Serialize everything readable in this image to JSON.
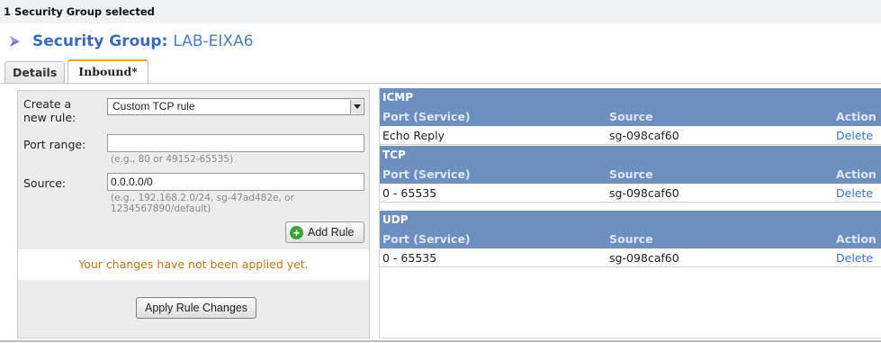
{
  "selection_bar": {
    "text": "1 Security Group selected"
  },
  "header": {
    "label": "Security Group:",
    "name": "LAB-EIXA6",
    "icon": "diamond-icon"
  },
  "tabs": [
    {
      "label": "Details",
      "active": false
    },
    {
      "label": "Inbound*",
      "active": true
    }
  ],
  "create_rule": {
    "rule_label": "Create a new rule:",
    "rule_value": "Custom TCP rule",
    "port_label": "Port range:",
    "port_value": "",
    "port_hint": "(e.g., 80 or 49152-65535)",
    "source_label": "Source:",
    "source_value": "0.0.0.0/0",
    "source_hint": "(e.g., 192.168.2.0/24, sg-47ad482e, or 1234567890/default)",
    "add_button": "Add Rule",
    "warning": "Your changes have not been applied yet.",
    "apply_button": "Apply Rule Changes"
  },
  "rules": {
    "columns": {
      "port": "Port (Service)",
      "source": "Source",
      "action": "Action"
    },
    "groups": [
      {
        "name": "ICMP",
        "row": {
          "port": "Echo Reply",
          "source": "sg-098caf60",
          "action": "Delete"
        }
      },
      {
        "name": "TCP",
        "row": {
          "port": "0 - 65535",
          "source": "sg-098caf60",
          "action": "Delete"
        }
      },
      {
        "name": "UDP",
        "row": {
          "port": "0 - 65535",
          "source": "sg-098caf60",
          "action": "Delete"
        }
      }
    ]
  },
  "colors": {
    "group_header": "#6d8fc0",
    "title": "#3a6cb5",
    "warning": "#c27314",
    "link": "#3b72c3",
    "tab_accent": "#f0a030"
  }
}
